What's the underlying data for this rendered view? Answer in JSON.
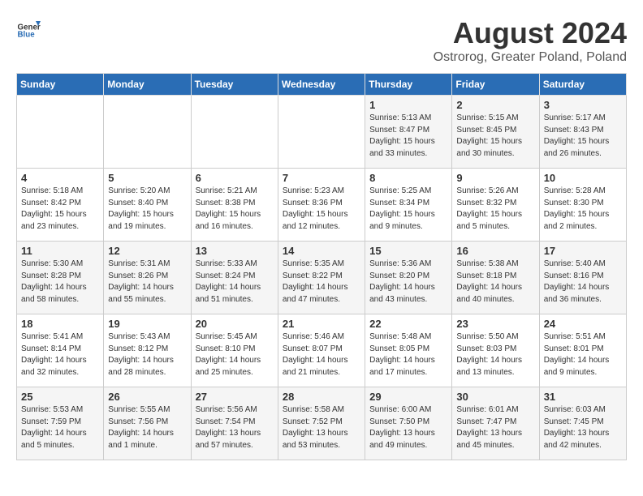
{
  "header": {
    "logo_general": "General",
    "logo_blue": "Blue",
    "month_title": "August 2024",
    "location": "Ostrorog, Greater Poland, Poland"
  },
  "days_of_week": [
    "Sunday",
    "Monday",
    "Tuesday",
    "Wednesday",
    "Thursday",
    "Friday",
    "Saturday"
  ],
  "weeks": [
    [
      {
        "day": "",
        "info": ""
      },
      {
        "day": "",
        "info": ""
      },
      {
        "day": "",
        "info": ""
      },
      {
        "day": "",
        "info": ""
      },
      {
        "day": "1",
        "info": "Sunrise: 5:13 AM\nSunset: 8:47 PM\nDaylight: 15 hours\nand 33 minutes."
      },
      {
        "day": "2",
        "info": "Sunrise: 5:15 AM\nSunset: 8:45 PM\nDaylight: 15 hours\nand 30 minutes."
      },
      {
        "day": "3",
        "info": "Sunrise: 5:17 AM\nSunset: 8:43 PM\nDaylight: 15 hours\nand 26 minutes."
      }
    ],
    [
      {
        "day": "4",
        "info": "Sunrise: 5:18 AM\nSunset: 8:42 PM\nDaylight: 15 hours\nand 23 minutes."
      },
      {
        "day": "5",
        "info": "Sunrise: 5:20 AM\nSunset: 8:40 PM\nDaylight: 15 hours\nand 19 minutes."
      },
      {
        "day": "6",
        "info": "Sunrise: 5:21 AM\nSunset: 8:38 PM\nDaylight: 15 hours\nand 16 minutes."
      },
      {
        "day": "7",
        "info": "Sunrise: 5:23 AM\nSunset: 8:36 PM\nDaylight: 15 hours\nand 12 minutes."
      },
      {
        "day": "8",
        "info": "Sunrise: 5:25 AM\nSunset: 8:34 PM\nDaylight: 15 hours\nand 9 minutes."
      },
      {
        "day": "9",
        "info": "Sunrise: 5:26 AM\nSunset: 8:32 PM\nDaylight: 15 hours\nand 5 minutes."
      },
      {
        "day": "10",
        "info": "Sunrise: 5:28 AM\nSunset: 8:30 PM\nDaylight: 15 hours\nand 2 minutes."
      }
    ],
    [
      {
        "day": "11",
        "info": "Sunrise: 5:30 AM\nSunset: 8:28 PM\nDaylight: 14 hours\nand 58 minutes."
      },
      {
        "day": "12",
        "info": "Sunrise: 5:31 AM\nSunset: 8:26 PM\nDaylight: 14 hours\nand 55 minutes."
      },
      {
        "day": "13",
        "info": "Sunrise: 5:33 AM\nSunset: 8:24 PM\nDaylight: 14 hours\nand 51 minutes."
      },
      {
        "day": "14",
        "info": "Sunrise: 5:35 AM\nSunset: 8:22 PM\nDaylight: 14 hours\nand 47 minutes."
      },
      {
        "day": "15",
        "info": "Sunrise: 5:36 AM\nSunset: 8:20 PM\nDaylight: 14 hours\nand 43 minutes."
      },
      {
        "day": "16",
        "info": "Sunrise: 5:38 AM\nSunset: 8:18 PM\nDaylight: 14 hours\nand 40 minutes."
      },
      {
        "day": "17",
        "info": "Sunrise: 5:40 AM\nSunset: 8:16 PM\nDaylight: 14 hours\nand 36 minutes."
      }
    ],
    [
      {
        "day": "18",
        "info": "Sunrise: 5:41 AM\nSunset: 8:14 PM\nDaylight: 14 hours\nand 32 minutes."
      },
      {
        "day": "19",
        "info": "Sunrise: 5:43 AM\nSunset: 8:12 PM\nDaylight: 14 hours\nand 28 minutes."
      },
      {
        "day": "20",
        "info": "Sunrise: 5:45 AM\nSunset: 8:10 PM\nDaylight: 14 hours\nand 25 minutes."
      },
      {
        "day": "21",
        "info": "Sunrise: 5:46 AM\nSunset: 8:07 PM\nDaylight: 14 hours\nand 21 minutes."
      },
      {
        "day": "22",
        "info": "Sunrise: 5:48 AM\nSunset: 8:05 PM\nDaylight: 14 hours\nand 17 minutes."
      },
      {
        "day": "23",
        "info": "Sunrise: 5:50 AM\nSunset: 8:03 PM\nDaylight: 14 hours\nand 13 minutes."
      },
      {
        "day": "24",
        "info": "Sunrise: 5:51 AM\nSunset: 8:01 PM\nDaylight: 14 hours\nand 9 minutes."
      }
    ],
    [
      {
        "day": "25",
        "info": "Sunrise: 5:53 AM\nSunset: 7:59 PM\nDaylight: 14 hours\nand 5 minutes."
      },
      {
        "day": "26",
        "info": "Sunrise: 5:55 AM\nSunset: 7:56 PM\nDaylight: 14 hours\nand 1 minute."
      },
      {
        "day": "27",
        "info": "Sunrise: 5:56 AM\nSunset: 7:54 PM\nDaylight: 13 hours\nand 57 minutes."
      },
      {
        "day": "28",
        "info": "Sunrise: 5:58 AM\nSunset: 7:52 PM\nDaylight: 13 hours\nand 53 minutes."
      },
      {
        "day": "29",
        "info": "Sunrise: 6:00 AM\nSunset: 7:50 PM\nDaylight: 13 hours\nand 49 minutes."
      },
      {
        "day": "30",
        "info": "Sunrise: 6:01 AM\nSunset: 7:47 PM\nDaylight: 13 hours\nand 45 minutes."
      },
      {
        "day": "31",
        "info": "Sunrise: 6:03 AM\nSunset: 7:45 PM\nDaylight: 13 hours\nand 42 minutes."
      }
    ]
  ]
}
